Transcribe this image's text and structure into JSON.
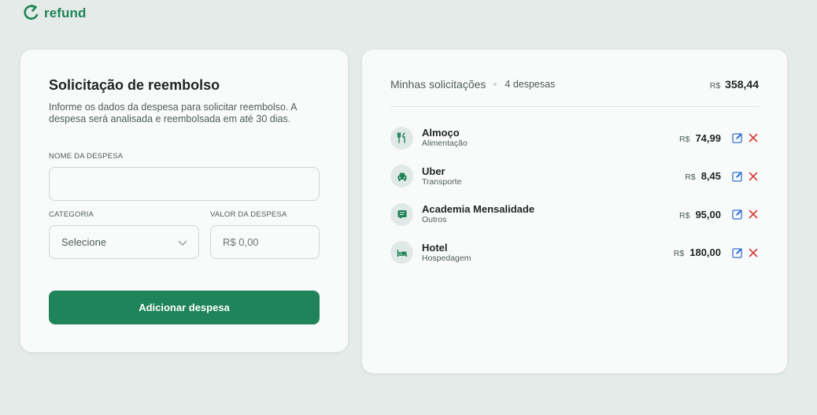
{
  "app": {
    "name": "refund",
    "brand_color": "#1f8459"
  },
  "form": {
    "title": "Solicitação de reembolso",
    "description": "Informe os dados da despesa para solicitar reembolso. A despesa será analisada e reembolsada em até 30 dias.",
    "name_label": "NOME DA DESPESA",
    "name_value": "",
    "category_label": "CATEGORIA",
    "category_selected": "Selecione",
    "value_label": "VALOR DA DESPESA",
    "value_placeholder": "R$ 0,00",
    "submit_label": "Adicionar despesa"
  },
  "list": {
    "title": "Minhas solicitações",
    "count": "4 despesas",
    "total_currency": "R$",
    "total_amount": "358,44",
    "items": [
      {
        "name": "Almoço",
        "category": "Alimentação",
        "currency": "R$",
        "amount": "74,99",
        "icon": "food-icon"
      },
      {
        "name": "Uber",
        "category": "Transporte",
        "currency": "R$",
        "amount": "8,45",
        "icon": "car-icon"
      },
      {
        "name": "Academia Mensalidade",
        "category": "Outros",
        "currency": "R$",
        "amount": "95,00",
        "icon": "receipt-icon"
      },
      {
        "name": "Hotel",
        "category": "Hospedagem",
        "currency": "R$",
        "amount": "180,00",
        "icon": "bed-icon"
      }
    ]
  },
  "colors": {
    "accent": "#1f8459",
    "edit": "#2f6fd6",
    "delete": "#d83a3a",
    "background": "#e4ebe8"
  }
}
